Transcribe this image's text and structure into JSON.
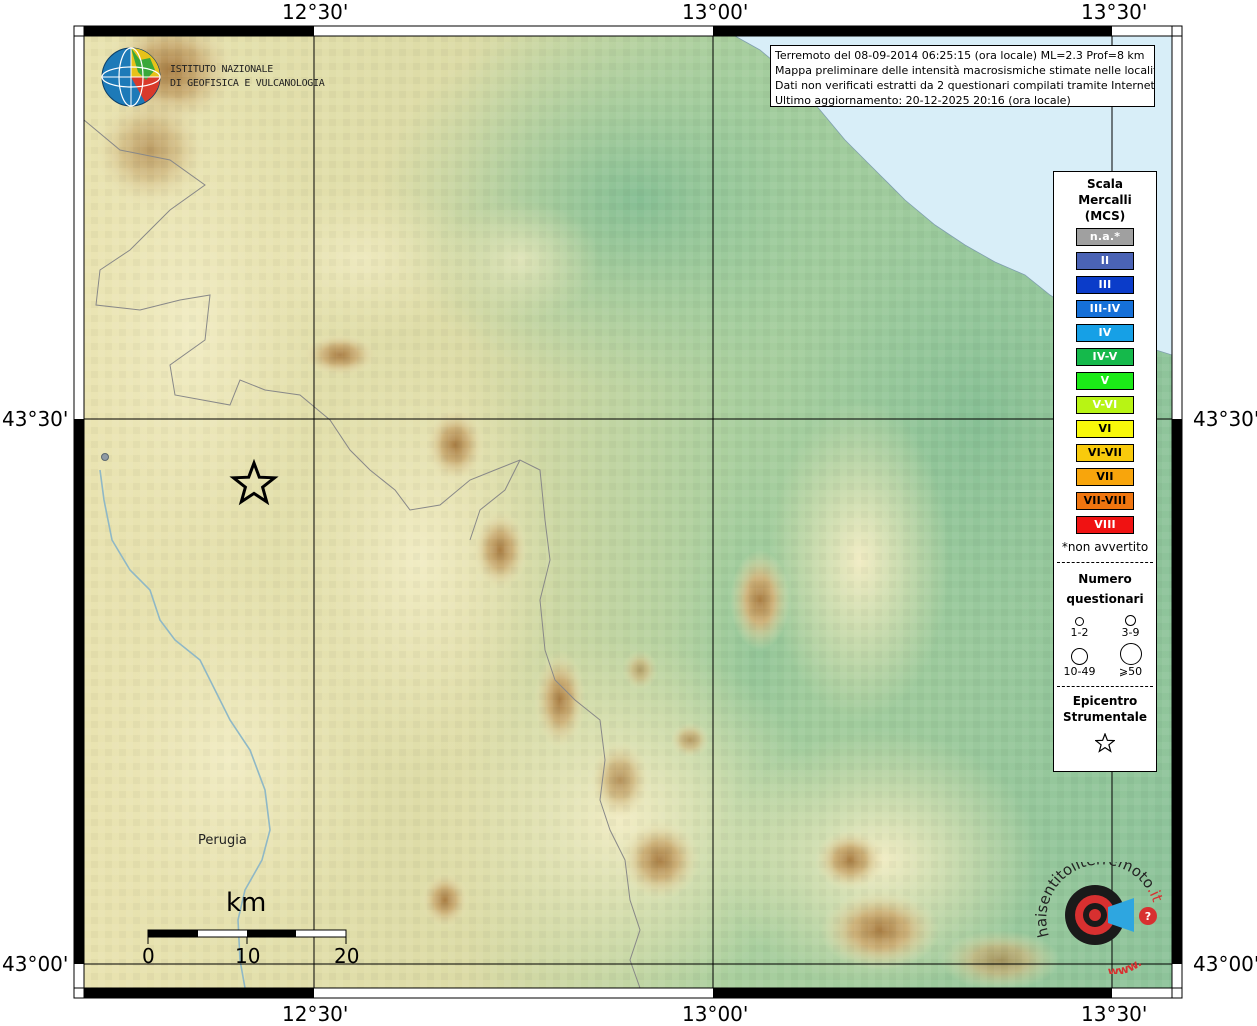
{
  "info": {
    "line1": "Terremoto del 08-09-2014 06:25:15 (ora locale) ML=2.3 Prof=8 km",
    "line2": "Mappa preliminare delle intensità macrosismiche stimate nelle località",
    "line3": "Dati non verificati estratti da 2 questionari compilati tramite Internet.",
    "line4": "Ultimo aggiornamento: 20-12-2025 20:16 (ora locale)"
  },
  "institute": {
    "line1": "ISTITUTO NAZIONALE",
    "line2": "DI GEOFISICA E VULCANOLOGIA"
  },
  "coords": {
    "lon_1230": "12°30'",
    "lon_1300": "13°00'",
    "lon_1330": "13°30'",
    "lat_4330": "43°30'",
    "lat_4300": "43°00'"
  },
  "city": "Perugia",
  "scalebar": {
    "unit": "km",
    "ticks": [
      "0",
      "10",
      "20"
    ]
  },
  "legend": {
    "title1": "Scala",
    "title2": "Mercalli",
    "title3": "(MCS)",
    "items": [
      {
        "label": "n.a.*",
        "color": "#a0a0a0"
      },
      {
        "label": "II",
        "color": "#4a63b5"
      },
      {
        "label": "III",
        "color": "#0b3cc9"
      },
      {
        "label": "III-IV",
        "color": "#1570d8"
      },
      {
        "label": "IV",
        "color": "#16a0e6"
      },
      {
        "label": "IV-V",
        "color": "#15b94b"
      },
      {
        "label": "V",
        "color": "#1bea17"
      },
      {
        "label": "V-VI",
        "color": "#b8f414"
      },
      {
        "label": "VI",
        "color": "#f8f80a"
      },
      {
        "label": "VI-VII",
        "color": "#f8ca0c"
      },
      {
        "label": "VII",
        "color": "#f8a50c"
      },
      {
        "label": "VII-VIII",
        "color": "#f0750f"
      },
      {
        "label": "VIII",
        "color": "#f01212"
      }
    ],
    "note": "*non avvertito",
    "count_title1": "Numero",
    "count_title2": "questionari",
    "count_labels": [
      "1-2",
      "3-9",
      "10-49",
      "⩾50"
    ],
    "epicenter_title1": "Epicentro",
    "epicenter_title2": "Strumentale"
  },
  "hst": {
    "text_main": "haisentitoilterremoto",
    "text_it": ".it",
    "text_www": "www."
  },
  "colors": {
    "sea": "#d8eef8",
    "lowland": "#8fc49b",
    "hill": "#e8e3b0",
    "mountain": "#b68a4a"
  }
}
